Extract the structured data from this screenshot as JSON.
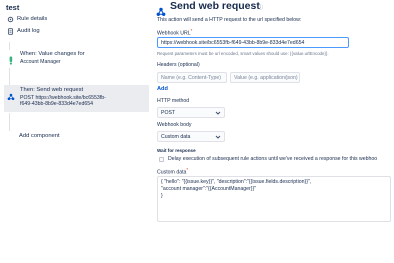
{
  "sidebar": {
    "title": "test",
    "nav": [
      {
        "label": "Rule details",
        "icon": "settings-icon"
      },
      {
        "label": "Audit log",
        "icon": "document-icon"
      }
    ],
    "steps": [
      {
        "title": "When: Value changes for",
        "subtitle": "Account Manager",
        "icon": "trigger-icon"
      },
      {
        "title": "Then: Send web request",
        "subtitle": "POST https://webhook.site/bc6553fb-f649-43bb-8b9e-833d4e7ed654",
        "subtitle_line1": "POST https://webhook.site/bc6553fb-",
        "subtitle_line2": "f649-43bb-8b9e-833d4e7ed654",
        "icon": "webhook-icon"
      }
    ],
    "add_component": "Add component"
  },
  "header": {
    "title": "Send web request"
  },
  "form": {
    "intro": "This action will send a HTTP request to the url specified below:",
    "url_label": "Webhook URL",
    "url_required": "*",
    "url_value": "https://webhook.site/bc6553fb-f649-43bb-8b9e-833d4e7ed654",
    "url_help": "Request parameters must be url encoded, smart values should use: {{value.urlEncode}}.",
    "headers_label": "Headers (optional)",
    "header_name_placeholder": "Name (e.g. Content-Type)",
    "header_value_placeholder": "Value (e.g. application/json)",
    "add_link": "Add",
    "method_label": "HTTP method",
    "method_value": "POST",
    "body_label": "Webhook body",
    "body_value": "Custom data",
    "wait_label": "Wait for response",
    "delay_text": "Delay execution of subsequent rule actions until we've received a response for this webhoo",
    "custom_label": "Custom data",
    "custom_required": "*",
    "custom_lines": [
      "{ \"hello\": \"{{issue.key}}\", \"description\":\"{{issue.fields.description}}\",",
      "\"account manager\":\"{{AccountManager}}\"",
      "}"
    ]
  },
  "colors": {
    "accent": "#0052cc",
    "focus_border": "#4c9aff",
    "active_step_bg": "#ebecf0",
    "trigger_green": "#36b37e",
    "required_red": "#de350b"
  }
}
